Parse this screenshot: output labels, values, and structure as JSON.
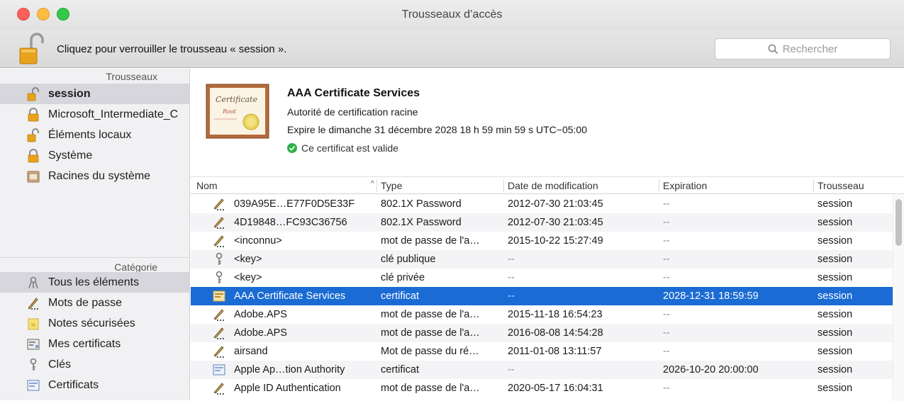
{
  "window": {
    "title": "Trousseaux d’accès"
  },
  "toolbar": {
    "lock_message": "Cliquez pour verrouiller le trousseau « session ».",
    "search_placeholder": "Rechercher"
  },
  "sidebar": {
    "keychains_heading": "Trousseaux",
    "keychains": [
      {
        "label": "session",
        "icon": "unlocked-padlock-icon",
        "selected": true
      },
      {
        "label": "Microsoft_Intermediate_C",
        "icon": "padlock-icon"
      },
      {
        "label": "Éléments locaux",
        "icon": "unlocked-padlock-icon"
      },
      {
        "label": "Système",
        "icon": "padlock-icon"
      },
      {
        "label": "Racines du système",
        "icon": "cabinet-icon"
      }
    ],
    "category_heading": "Catégorie",
    "categories": [
      {
        "label": "Tous les éléments",
        "icon": "all-items-icon",
        "selected": true
      },
      {
        "label": "Mots de passe",
        "icon": "pen-icon"
      },
      {
        "label": "Notes sécurisées",
        "icon": "note-icon"
      },
      {
        "label": "Mes certificats",
        "icon": "my-certificate-icon"
      },
      {
        "label": "Clés",
        "icon": "key-icon"
      },
      {
        "label": "Certificats",
        "icon": "certificate-icon"
      }
    ]
  },
  "detail": {
    "title": "AAA Certificate Services",
    "subtitle": "Autorité de certification racine",
    "expires": "Expire le dimanche 31 décembre 2028 18 h 59 min 59 s UTC−05:00",
    "status": "Ce certificat est valide",
    "status_color": "#2fb14a"
  },
  "table": {
    "columns": {
      "name": "Nom",
      "type": "Type",
      "modified": "Date de modification",
      "expiration": "Expiration",
      "keychain": "Trousseau"
    },
    "sort_indicator": "^",
    "rows": [
      {
        "icon": "pen-icon",
        "name": "039A95E…E77F0D5E33F",
        "type": "802.1X Password",
        "modified": "2012-07-30 21:03:45",
        "expiration": "--",
        "keychain": "session"
      },
      {
        "icon": "pen-icon",
        "name": "4D19848…FC93C36756",
        "type": "802.1X Password",
        "modified": "2012-07-30 21:03:45",
        "expiration": "--",
        "keychain": "session"
      },
      {
        "icon": "pen-icon",
        "name": "<inconnu>",
        "type": "mot de passe de l'a…",
        "modified": "2015-10-22 15:27:49",
        "expiration": "--",
        "keychain": "session"
      },
      {
        "icon": "key-icon",
        "name": "<key>",
        "type": "clé publique",
        "modified": "--",
        "expiration": "--",
        "keychain": "session"
      },
      {
        "icon": "key-icon",
        "name": "<key>",
        "type": "clé privée",
        "modified": "--",
        "expiration": "--",
        "keychain": "session"
      },
      {
        "icon": "certificate-icon",
        "name": "AAA Certificate Services",
        "type": "certificat",
        "modified": "--",
        "expiration": "2028-12-31 18:59:59",
        "keychain": "session",
        "selected": true
      },
      {
        "icon": "pen-icon",
        "name": "Adobe.APS",
        "type": "mot de passe de l'a…",
        "modified": "2015-11-18 16:54:23",
        "expiration": "--",
        "keychain": "session"
      },
      {
        "icon": "pen-icon",
        "name": "Adobe.APS",
        "type": "mot de passe de l'a…",
        "modified": "2016-08-08 14:54:28",
        "expiration": "--",
        "keychain": "session"
      },
      {
        "icon": "pen-icon",
        "name": "airsand",
        "type": "Mot de passe du ré…",
        "modified": "2011-01-08 13:11:57",
        "expiration": "--",
        "keychain": "session"
      },
      {
        "icon": "certificate-icon",
        "name": "Apple Ap…tion Authority",
        "type": "certificat",
        "modified": "--",
        "expiration": "2026-10-20 20:00:00",
        "keychain": "session"
      },
      {
        "icon": "pen-icon",
        "name": "Apple ID Authentication",
        "type": "mot de passe de l'a…",
        "modified": "2020-05-17 16:04:31",
        "expiration": "--",
        "keychain": "session"
      }
    ]
  },
  "colors": {
    "selection": "#1a6bd3",
    "padlock": "#e8a21c"
  }
}
